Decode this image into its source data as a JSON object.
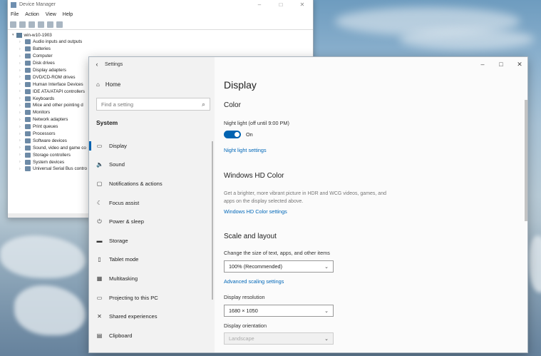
{
  "device_manager": {
    "title": "Device Manager",
    "menu": [
      "File",
      "Action",
      "View",
      "Help"
    ],
    "root": "win-w10-1903",
    "nodes": [
      "Audio inputs and outputs",
      "Batteries",
      "Computer",
      "Disk drives",
      "Display adapters",
      "DVD/CD-ROM drives",
      "Human Interface Devices",
      "IDE ATA/ATAPI controllers",
      "Keyboards",
      "Mice and other pointing d",
      "Monitors",
      "Network adapters",
      "Print queues",
      "Processors",
      "Software devices",
      "Sound, video and game co",
      "Storage controllers",
      "System devices",
      "Universal Serial Bus contro"
    ]
  },
  "settings": {
    "title": "Settings",
    "home": "Home",
    "search_placeholder": "Find a setting",
    "section": "System",
    "nav": [
      {
        "label": "Display",
        "icon": "monitor-icon",
        "glyph": "▭"
      },
      {
        "label": "Sound",
        "icon": "speaker-icon",
        "glyph": "🔈"
      },
      {
        "label": "Notifications & actions",
        "icon": "notifications-icon",
        "glyph": "▢"
      },
      {
        "label": "Focus assist",
        "icon": "moon-icon",
        "glyph": "☾"
      },
      {
        "label": "Power & sleep",
        "icon": "power-icon",
        "glyph": "⏻"
      },
      {
        "label": "Storage",
        "icon": "storage-icon",
        "glyph": "▬"
      },
      {
        "label": "Tablet mode",
        "icon": "tablet-icon",
        "glyph": "▯"
      },
      {
        "label": "Multitasking",
        "icon": "multitasking-icon",
        "glyph": "▦"
      },
      {
        "label": "Projecting to this PC",
        "icon": "projector-icon",
        "glyph": "▭"
      },
      {
        "label": "Shared experiences",
        "icon": "shared-icon",
        "glyph": "✕"
      },
      {
        "label": "Clipboard",
        "icon": "clipboard-icon",
        "glyph": "▤"
      }
    ],
    "page_title": "Display",
    "color": {
      "heading": "Color",
      "night_light_label": "Night light (off until 9:00 PM)",
      "toggle_state": "On",
      "night_light_link": "Night light settings"
    },
    "hdr": {
      "heading": "Windows HD Color",
      "description": "Get a brighter, more vibrant picture in HDR and WCG videos, games, and apps on the display selected above.",
      "link": "Windows HD Color settings"
    },
    "scale": {
      "heading": "Scale and layout",
      "size_label": "Change the size of text, apps, and other items",
      "size_value": "100% (Recommended)",
      "advanced_link": "Advanced scaling settings",
      "resolution_label": "Display resolution",
      "resolution_value": "1680 × 1050",
      "orientation_label": "Display orientation",
      "orientation_value": "Landscape"
    }
  }
}
